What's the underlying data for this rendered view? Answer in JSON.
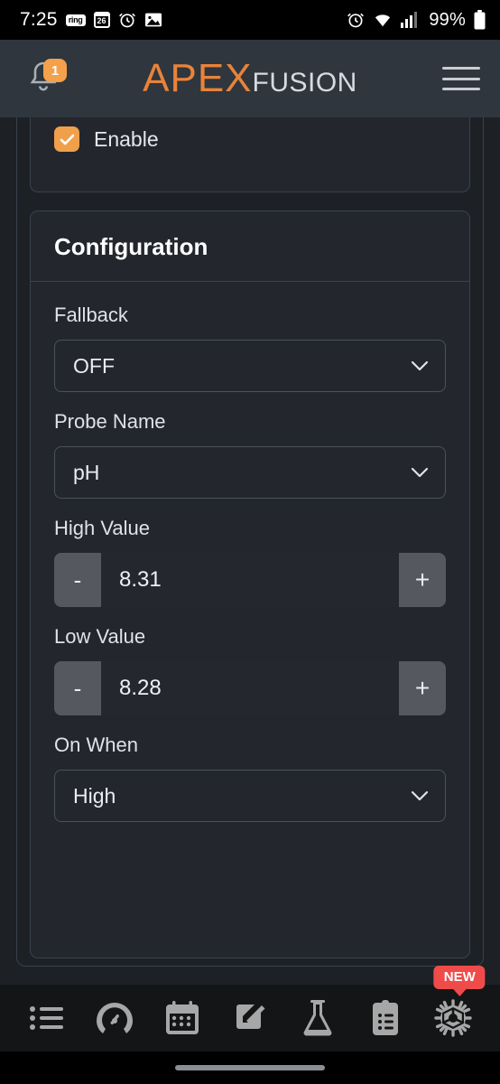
{
  "statusbar": {
    "time": "7:25",
    "ring_label": "ring",
    "calendar_day": "26",
    "alarm_icon": "alarm-clock-icon",
    "photo_icon": "image-icon",
    "alarm_right_icon": "alarm-clock-icon",
    "wifi_icon": "wifi-icon",
    "signal_icon": "cellular-signal-icon",
    "battery_percent": "99%",
    "battery_icon": "battery-full-icon"
  },
  "header": {
    "bell_icon": "notification-bell-icon",
    "notification_count": "1",
    "brand_primary": "APEX",
    "brand_secondary": "FUSION",
    "menu_icon": "hamburger-menu-icon",
    "brand_primary_color": "#e8833a",
    "brand_secondary_color": "#d7dbe0",
    "background_color": "#2f363d"
  },
  "enable_card": {
    "checkbox_label": "Enable",
    "checkbox_checked": true,
    "checkbox_color": "#f0a04b"
  },
  "configuration": {
    "title": "Configuration",
    "fields": [
      {
        "label": "Fallback",
        "type": "select",
        "value": "OFF",
        "name": "fallback"
      },
      {
        "label": "Probe Name",
        "type": "select",
        "value": "pH",
        "name": "probe-name"
      },
      {
        "label": "High Value",
        "type": "stepper",
        "value": "8.31",
        "decrement_label": "-",
        "increment_label": "+",
        "name": "high-value"
      },
      {
        "label": "Low Value",
        "type": "stepper",
        "value": "8.28",
        "decrement_label": "-",
        "increment_label": "+",
        "name": "low-value"
      },
      {
        "label": "On When",
        "type": "select",
        "value": "High",
        "name": "on-when"
      }
    ]
  },
  "tabbar": {
    "items": [
      {
        "icon": "list-icon",
        "name": "tab-list"
      },
      {
        "icon": "dashboard-gauge-icon",
        "name": "tab-dashboard"
      },
      {
        "icon": "calendar-icon",
        "name": "tab-calendar"
      },
      {
        "icon": "edit-pencil-icon",
        "name": "tab-edit"
      },
      {
        "icon": "flask-icon",
        "name": "tab-lab"
      },
      {
        "icon": "clipboard-icon",
        "name": "tab-tasks"
      },
      {
        "icon": "gear-icon",
        "name": "tab-settings"
      }
    ],
    "new_badge_label": "NEW",
    "new_badge_color": "#ef4b4b",
    "new_badge_on": "tab-settings"
  }
}
